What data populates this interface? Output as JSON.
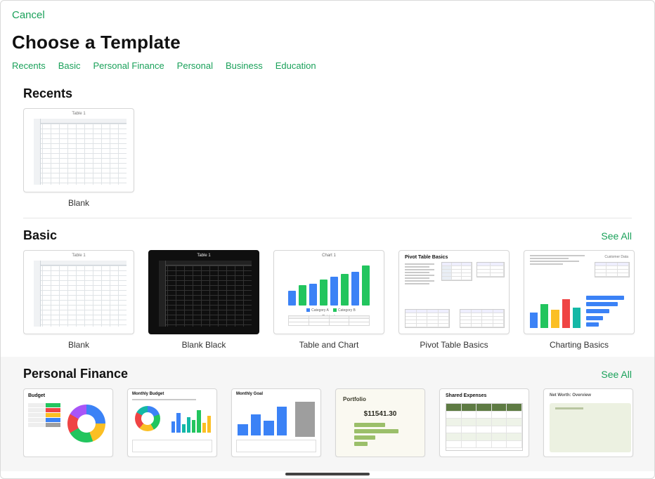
{
  "topbar": {
    "cancel": "Cancel"
  },
  "title": "Choose a Template",
  "tabs": [
    "Recents",
    "Basic",
    "Personal Finance",
    "Personal",
    "Business",
    "Education"
  ],
  "see_all": "See All",
  "sections": {
    "recents": {
      "title": "Recents",
      "items": [
        {
          "label": "Blank",
          "sheet_label": "Table 1"
        }
      ]
    },
    "basic": {
      "title": "Basic",
      "items": [
        {
          "label": "Blank",
          "sheet_label": "Table 1"
        },
        {
          "label": "Blank Black",
          "sheet_label": "Table 1"
        },
        {
          "label": "Table and Chart",
          "chart_label": "Chart 1",
          "table_label": "Table 1",
          "legend_a": "Category A",
          "legend_b": "Category B"
        },
        {
          "label": "Pivot Table Basics",
          "heading": "Pivot Table Basics"
        },
        {
          "label": "Charting Basics"
        }
      ]
    },
    "personal_finance": {
      "title": "Personal Finance",
      "items": [
        {
          "label": "Budget",
          "heading": "Budget"
        },
        {
          "label": "Monthly Budget",
          "heading": "Monthly Budget"
        },
        {
          "label": "Monthly Goal",
          "heading": "Monthly Goal"
        },
        {
          "label": "Portfolio",
          "heading": "Portfolio",
          "total": "$11541.30"
        },
        {
          "label": "Shared Expenses",
          "heading": "Shared Expenses"
        },
        {
          "label": "Net Worth Overview",
          "heading": "Net Worth: Overview"
        }
      ]
    }
  }
}
